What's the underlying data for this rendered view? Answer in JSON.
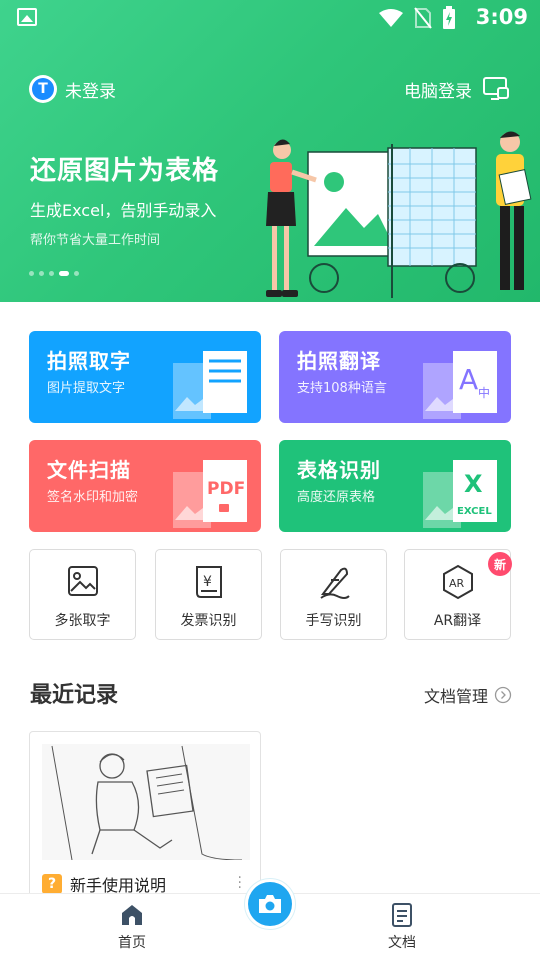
{
  "status_bar": {
    "time": "3:09"
  },
  "header": {
    "login_text": "未登录",
    "avatar_letter": "T",
    "pc_login": "电脑登录"
  },
  "banner": {
    "title": "还原图片为表格",
    "subtitle": "生成Excel，告别手动录入",
    "caption": "帮你节省大量工作时间",
    "active_dot": 3
  },
  "feature_cards": [
    {
      "title": "拍照取字",
      "subtitle": "图片提取文字",
      "color": "#12a3ff"
    },
    {
      "title": "拍照翻译",
      "subtitle": "支持108种语言",
      "color": "#8474ff"
    },
    {
      "title": "文件扫描",
      "subtitle": "签名水印和加密",
      "color": "#ff6868",
      "icon_text": "PDF"
    },
    {
      "title": "表格识别",
      "subtitle": "高度还原表格",
      "color": "#1fc27a",
      "icon_text": "EXCEL"
    }
  ],
  "tools": [
    {
      "label": "多张取字",
      "icon": "image-stack-icon"
    },
    {
      "label": "发票识别",
      "icon": "invoice-icon"
    },
    {
      "label": "手写识别",
      "icon": "handwriting-icon"
    },
    {
      "label": "AR翻译",
      "icon": "ar-hexagon-icon",
      "icon_text": "AR",
      "badge": "新"
    }
  ],
  "recent": {
    "title": "最近记录",
    "manage_label": "文档管理",
    "items": [
      {
        "name": "新手使用说明"
      }
    ]
  },
  "bottom_nav": [
    {
      "label": "首页"
    },
    {
      "label": "文档"
    }
  ]
}
